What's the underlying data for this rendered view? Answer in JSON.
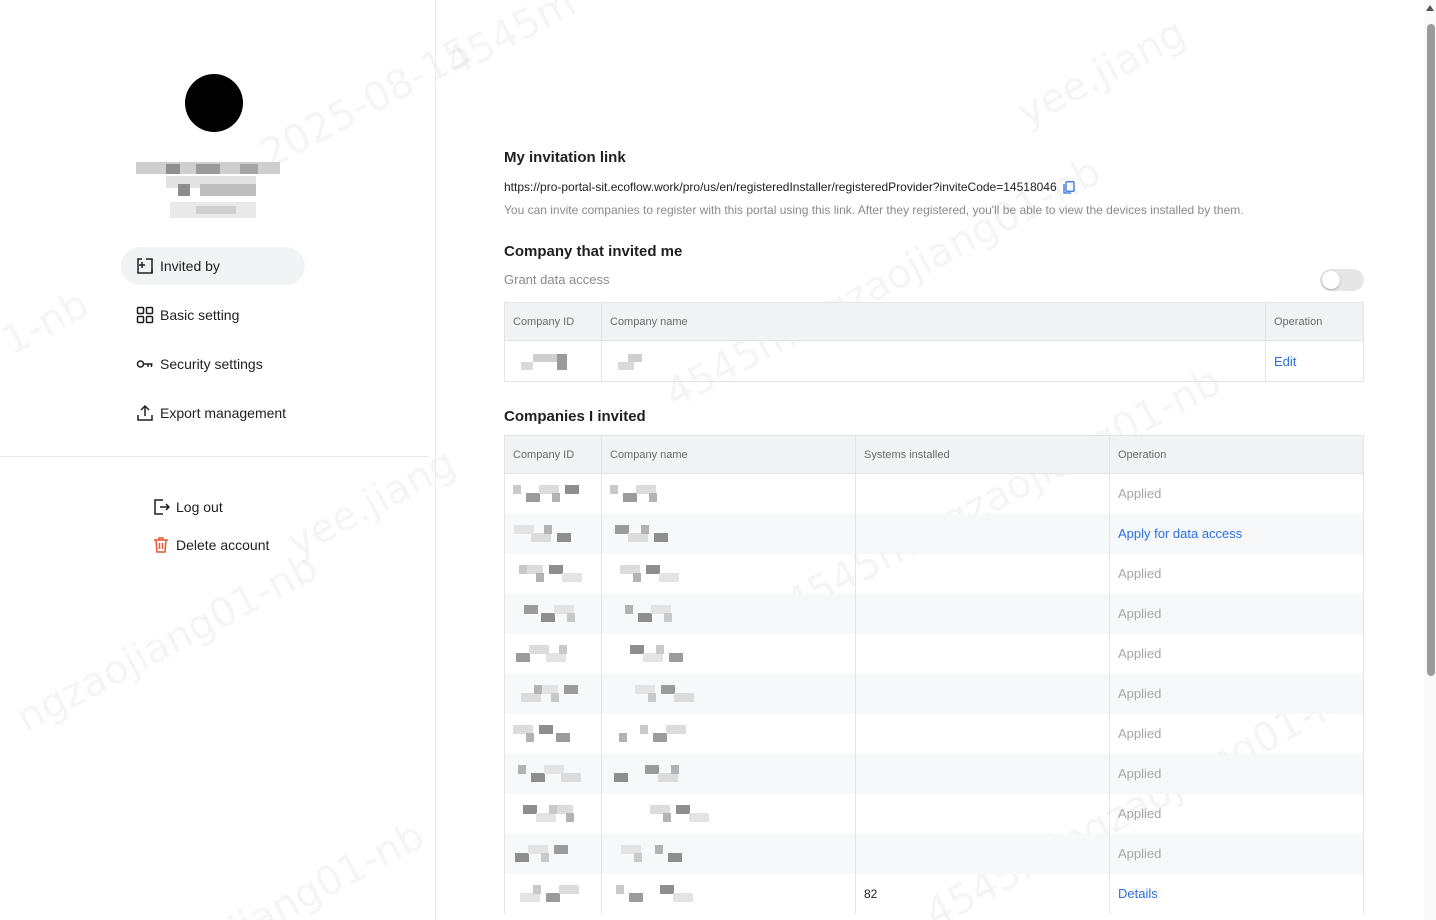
{
  "sidebar": {
    "nav": [
      {
        "label": "Invited by",
        "icon": "invite-icon",
        "active": true
      },
      {
        "label": "Basic setting",
        "icon": "grid-icon",
        "active": false
      },
      {
        "label": "Security settings",
        "icon": "key-icon",
        "active": false
      },
      {
        "label": "Export management",
        "icon": "export-icon",
        "active": false
      }
    ],
    "actions": [
      {
        "label": "Log out",
        "icon": "logout-icon"
      },
      {
        "label": "Delete account",
        "icon": "trash-icon"
      }
    ]
  },
  "main": {
    "invitation": {
      "title": "My invitation link",
      "link": "https://pro-portal-sit.ecoflow.work/pro/us/en/registeredInstaller/registeredProvider?inviteCode=14518046",
      "hint": "You can invite companies to register with this portal using this link. After they registered, you'll be able to view the devices installed by them."
    },
    "invited_me": {
      "title": "Company that invited me",
      "grant_label": "Grant data access",
      "grant_enabled": false,
      "columns": [
        "Company ID",
        "Company name",
        "Operation"
      ],
      "rows": [
        {
          "operation": "Edit"
        }
      ]
    },
    "i_invited": {
      "title": "Companies I invited",
      "columns": [
        "Company ID",
        "Company name",
        "Systems installed",
        "Operation"
      ],
      "rows": [
        {
          "systems": "",
          "operation": "Applied",
          "type": "applied"
        },
        {
          "systems": "",
          "operation": "Apply for data access",
          "type": "link"
        },
        {
          "systems": "",
          "operation": "Applied",
          "type": "applied"
        },
        {
          "systems": "",
          "operation": "Applied",
          "type": "applied"
        },
        {
          "systems": "",
          "operation": "Applied",
          "type": "applied"
        },
        {
          "systems": "",
          "operation": "Applied",
          "type": "applied"
        },
        {
          "systems": "",
          "operation": "Applied",
          "type": "applied"
        },
        {
          "systems": "",
          "operation": "Applied",
          "type": "applied"
        },
        {
          "systems": "",
          "operation": "Applied",
          "type": "applied"
        },
        {
          "systems": "",
          "operation": "Applied",
          "type": "applied"
        },
        {
          "systems": "82",
          "operation": "Details",
          "type": "link"
        }
      ]
    }
  },
  "colors": {
    "link": "#2b6fe0",
    "danger": "#e8572f",
    "muted": "#a6a6a6",
    "header_bg": "#f2f3f5"
  }
}
